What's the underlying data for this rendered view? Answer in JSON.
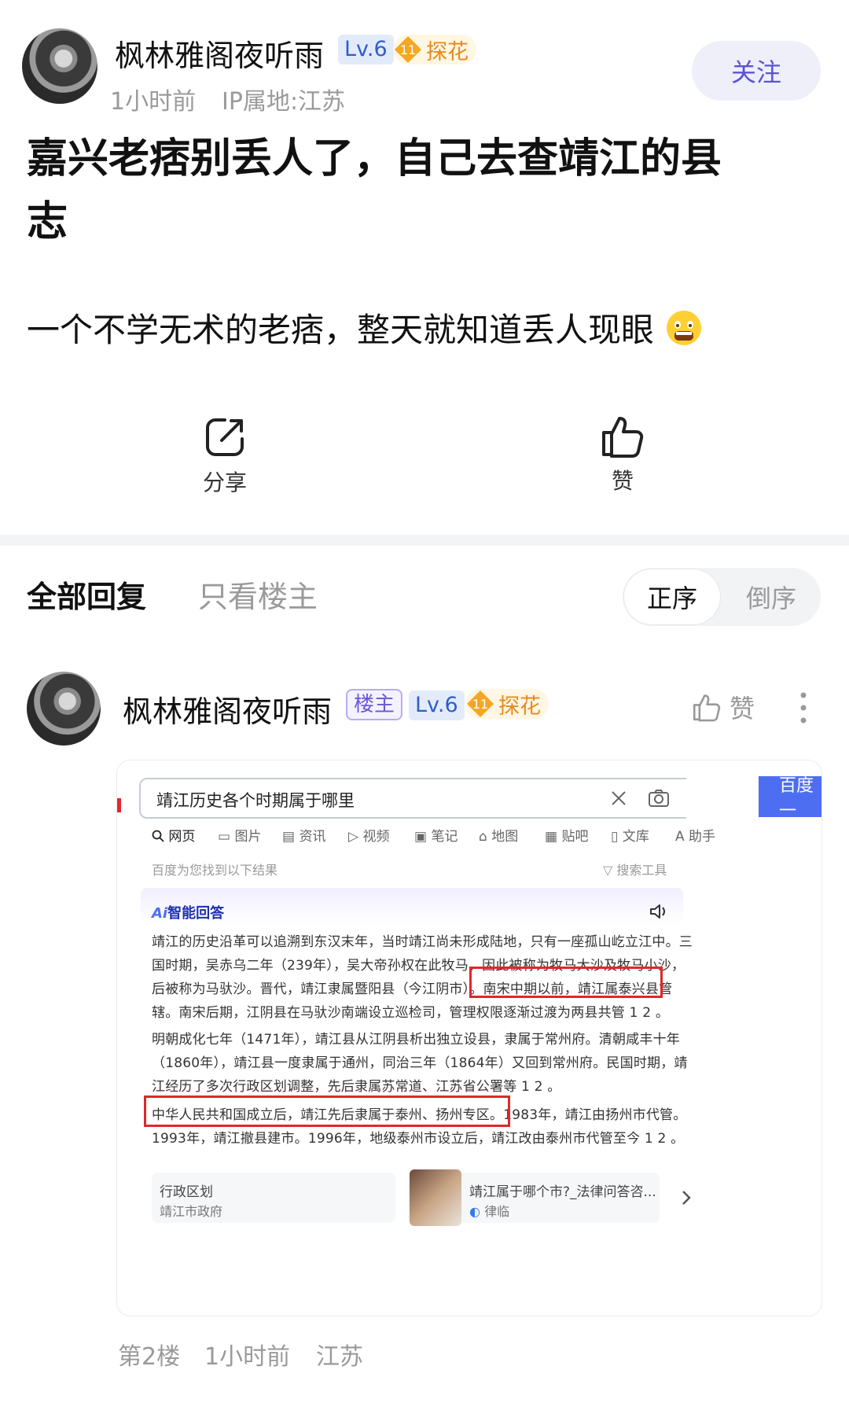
{
  "post": {
    "author": "枫林雅阁夜听雨",
    "level": "Lv.6",
    "badge_num": "11",
    "badge_title": "探花",
    "time": "1小时前",
    "ip": "IP属地:江苏",
    "follow_label": "关注",
    "title_line1": "嘉兴老痞别丢人了，自己去查靖江的县",
    "title_line2": "志",
    "body": "一个不学无术的老痞，整天就知道丢人现眼",
    "emoji": "😲",
    "share_label": "分享",
    "like_label": "赞"
  },
  "reply_bar": {
    "tab_all": "全部回复",
    "tab_owner": "只看楼主",
    "sort_asc": "正序",
    "sort_desc": "倒序"
  },
  "reply": {
    "author": "枫林雅阁夜听雨",
    "owner_tag": "楼主",
    "level": "Lv.6",
    "badge_num": "11",
    "badge_title": "探花",
    "like_label": "赞",
    "floor": "第2楼",
    "time": "1小时前",
    "location": "江苏"
  },
  "screenshot": {
    "query": "靖江历史各个时期属于哪里",
    "search_button": "百度一",
    "nav": [
      "网页",
      "图片",
      "资讯",
      "视频",
      "笔记",
      "地图",
      "贴吧",
      "文库",
      "助手"
    ],
    "result_hint": "百度为您找到以下结果",
    "search_tools": "搜索工具",
    "ai_title": "智能回答",
    "ai_prefix": "Ai",
    "lines": [
      "靖江的历史沿革可以追溯到东汉末年，当时靖江尚未形成陆地，只有一座孤山屹立江中。三",
      "国时期，吴赤乌二年（239年），吴大帝孙权在此牧马，因此被称为牧马大沙及牧马小沙，",
      "后被称为马驮沙。晋代，靖江隶属暨阳县（今江阴市）。南宋中期以前，靖江属泰兴县管",
      "辖。南宋后期，江阴县在马驮沙南端设立巡检司，管理权限逐渐过渡为两县共管  1  2 。",
      "明朝成化七年（1471年），靖江县从江阴县析出独立设县，隶属于常州府。清朝咸丰十年",
      "（1860年），靖江县一度隶属于通州，同治三年（1864年）又回到常州府。民国时期，靖",
      "江经历了多次行政区划调整，先后隶属苏常道、江苏省公署等  1  2 。",
      "中华人民共和国成立后，靖江先后隶属于泰州、扬州专区。1983年，靖江由扬州市代管。",
      "1993年，靖江撤县建市。1996年，地级泰州市设立后，靖江改由泰州市代管至今  1  2 。"
    ],
    "ref1_title": "行政区划",
    "ref1_sub": "靖江市政府",
    "ref2_title": "靖江属于哪个市?_法律问答咨...",
    "ref2_sub": "律临"
  }
}
